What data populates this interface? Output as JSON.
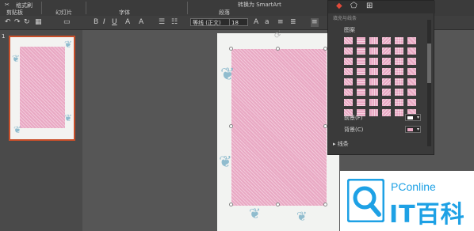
{
  "ribbon": {
    "groups": [
      {
        "label": "✂"
      },
      {
        "label": "格式刷"
      },
      {
        "label": "剪贴板"
      },
      {
        "label": "幻灯片"
      },
      {
        "label": "字体"
      },
      {
        "label": "段落"
      }
    ],
    "convert_smartart": "转换为 SmartArt"
  },
  "toolbar": {
    "font_name": "等线 (正文)",
    "font_size": "18",
    "icons": [
      "undo-icon",
      "redo-icon",
      "bold-icon",
      "italic-icon",
      "underline-icon",
      "align-icon"
    ]
  },
  "thumbnails": {
    "slide_number": "1"
  },
  "format_panel": {
    "title": "填充与线条",
    "pattern_label": "图案",
    "foreground_label": "前景(F)",
    "background_label": "背景(C)",
    "line_label": "线条",
    "colors": {
      "pattern_pink": "#e9a8c3",
      "panel_bg": "#3a3a3a"
    }
  },
  "watermark": {
    "small_text": "PConline",
    "big_text": "IT百科",
    "color": "#1ea1e5"
  }
}
